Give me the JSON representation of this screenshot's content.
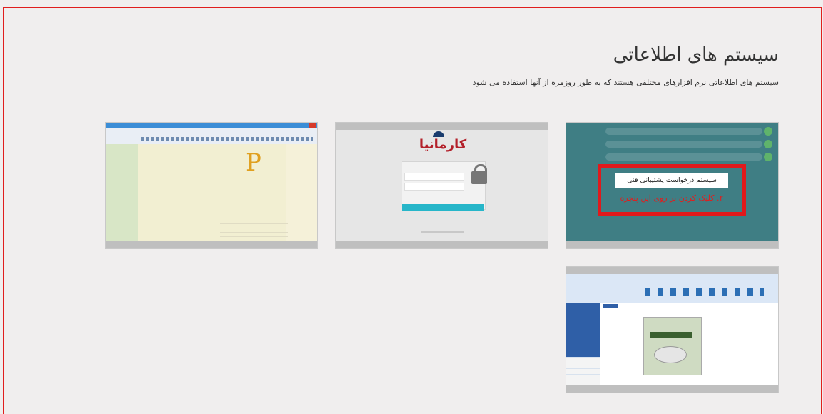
{
  "section": {
    "title": "سیستم های اطلاعاتی",
    "subtitle": "سیستم های اطلاعاتی نرم افزارهای مختلفی هستند که به طور روزمره از آنها استفاده می شود"
  },
  "cards": [
    {
      "name": "support-request-system",
      "label": "سیستم درخواست پشتیبانی فنی",
      "cta": "۲. کلیک کردن بر روی این پنجره"
    },
    {
      "name": "karmania-login",
      "logo_text": "کارمانیا"
    },
    {
      "name": "legacy-desktop-app"
    },
    {
      "name": "accounting-desktop-app"
    }
  ],
  "colors": {
    "frame_border": "#e01e1e",
    "highlight_box": "#e0191c",
    "card1_bg": "#3f7e84",
    "karmania_red": "#b3202a",
    "karmania_button": "#27b6c9"
  }
}
